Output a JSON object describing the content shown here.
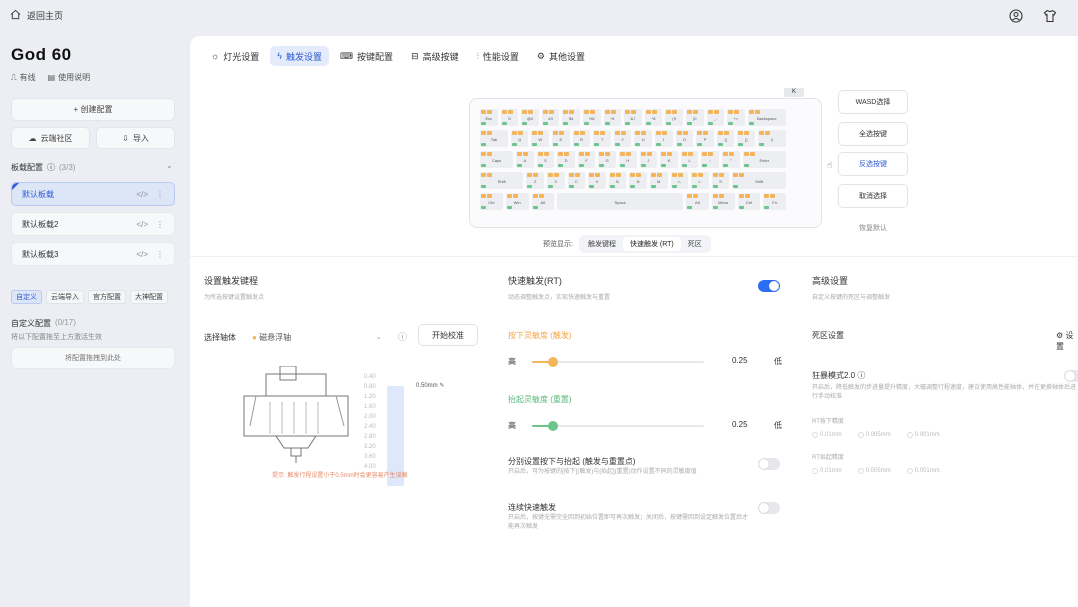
{
  "topbar": {
    "back_label": "返回主页"
  },
  "device": {
    "name": "God 60",
    "connection": "有线",
    "manual": "使用说明"
  },
  "sidebar": {
    "create_label": "+ 创建配置",
    "cloud_label": "云端社区",
    "import_label": "导入",
    "board_section": "板载配置",
    "board_count": "(3/3)",
    "profiles": [
      {
        "name": "默认板载"
      },
      {
        "name": "默认板载2"
      },
      {
        "name": "默认板载3"
      }
    ],
    "chips": [
      "自定义",
      "云端导入",
      "官方配置",
      "大神配置"
    ],
    "custom_section": "自定义配置",
    "custom_count": "(0/17)",
    "custom_hint": "将以下配置拖至上方激活生效",
    "custom_button": "将配置拖拽到此处"
  },
  "tabs": [
    {
      "label": "灯光设置",
      "icon": "bulb-icon"
    },
    {
      "label": "触发设置",
      "icon": "lightning-icon"
    },
    {
      "label": "按键配置",
      "icon": "keyboard-icon"
    },
    {
      "label": "高级按键",
      "icon": "advanced-key-icon"
    },
    {
      "label": "性能设置",
      "icon": "sliders-icon"
    },
    {
      "label": "其他设置",
      "icon": "gear-icon"
    }
  ],
  "keyboard": {
    "rows": [
      [
        "Esc",
        "!1",
        "@2",
        "#3",
        "$4",
        "%5",
        "^6",
        "&7",
        "*8",
        "(9",
        ")0",
        "_-",
        "+=",
        "Backspace"
      ],
      [
        "Tab",
        "Q",
        "W",
        "E",
        "R",
        "T",
        "Y",
        "U",
        "I",
        "O",
        "P",
        "{[",
        "}]",
        "|\\"
      ],
      [
        "Caps",
        "A",
        "S",
        "D",
        "F",
        "G",
        "H",
        "J",
        "K",
        "L",
        ":;",
        "\"'",
        "Enter"
      ],
      [
        "Shift",
        "Z",
        "X",
        "C",
        "V",
        "B",
        "N",
        "M",
        "<,",
        ">.",
        "?/",
        "Shift"
      ],
      [
        "Ctrl",
        "Win",
        "Alt",
        "Space",
        "Alt",
        "Menu",
        "Ctrl",
        "Fn"
      ]
    ],
    "badge": "K"
  },
  "select_buttons": [
    "WASD选择",
    "全选按键",
    "反选按键",
    "取消选择",
    "恢复默认"
  ],
  "preview": {
    "label": "预览显示:",
    "options": [
      "触发键程",
      "快速触发 (RT)",
      "死区"
    ]
  },
  "trigger": {
    "title": "设置触发键程",
    "subtitle": "为所选按键设置触发点",
    "axis_label": "选择轴体",
    "axis_value": "磁悬浮轴",
    "calibrate": "开始校准",
    "travel_value": "0.50mm",
    "ticks": [
      "0.40",
      "0.80",
      "1.20",
      "1.60",
      "2.00",
      "2.40",
      "2.80",
      "3.20",
      "3.60",
      "4.00"
    ],
    "warning": "提示: 触发行程设置小于0.5mm时会更容易产生误触"
  },
  "rt": {
    "title": "快速触发(RT)",
    "subtitle": "动态调整触发点，实现快速触发与重置",
    "press_label": "按下灵敏度 (触发)",
    "press_high": "高",
    "press_value": "0.25",
    "press_low": "低",
    "press_level": 0.12,
    "release_label": "抬起灵敏度 (重置)",
    "release_high": "高",
    "release_value": "0.25",
    "release_low": "低",
    "release_level": 0.12,
    "sep_title": "分别设置按下与抬起 (触发与重置点)",
    "sep_desc": "开启后，可为按键的[按下](触发)与[抬起](重置)动作设置不同的灵敏度值",
    "cont_title": "连续快速触发",
    "cont_desc": "开启后，按键无需完全回到初始位置即可再次触发；关闭后，按键需回到设定触发位置后才能再次触发"
  },
  "advanced": {
    "title": "高级设置",
    "subtitle": "自定义按键的死区与调整触发",
    "deadzone": "死区设置",
    "setting_label": "设置",
    "mode_title": "狂暴模式2.0",
    "mode_desc": "开启后，降低触发的步进量提升精度，大幅调整行程速度，建议使用高性能轴体，并在更换轴体后进行手动校准",
    "press_dz": "RT按下精度",
    "release_dz": "RT抬起精度",
    "options": [
      "0.01mm",
      "0.005mm",
      "0.001mm"
    ]
  },
  "colors": {
    "accent": "#2c6ef2",
    "orange": "#f3b45a",
    "green": "#6cc58a"
  }
}
